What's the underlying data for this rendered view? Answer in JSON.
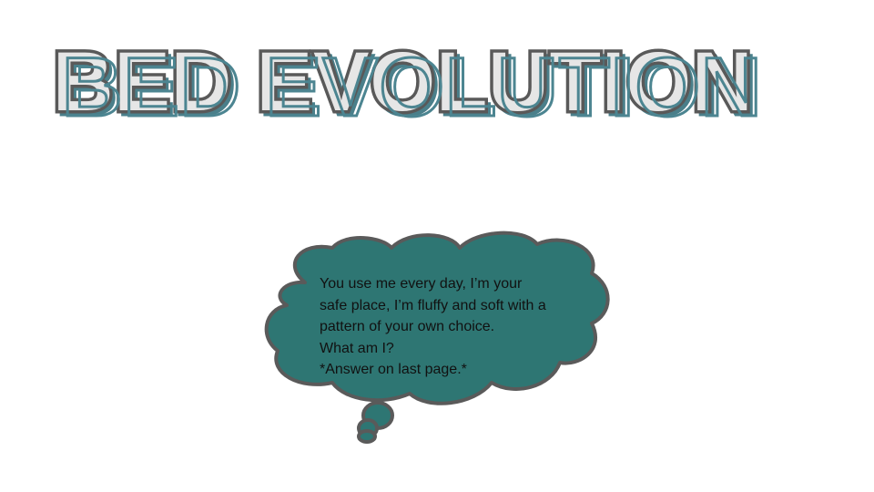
{
  "slide": {
    "title": "BED EVOLUTION",
    "bubble": {
      "lines": [
        "You use me every day, I’m your",
        "safe place, I’m fluffy and soft with a",
        "pattern of your own choice.",
        "What am I?",
        "*Answer on last page.*"
      ]
    }
  },
  "colors": {
    "cloud_fill": "#2e7673",
    "cloud_stroke": "#5a5a5a",
    "title_outline": "#595959",
    "title_teal": "#4a7f8a"
  }
}
